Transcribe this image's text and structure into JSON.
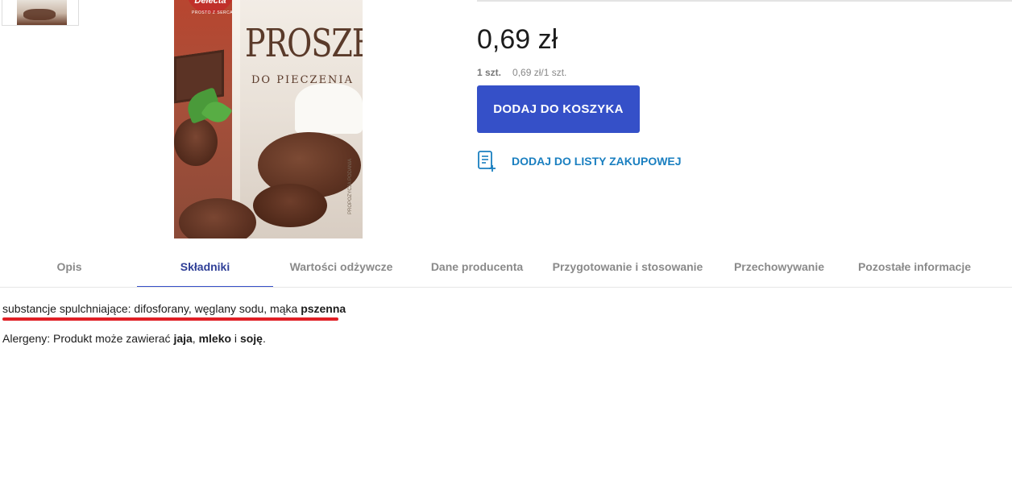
{
  "product": {
    "image_brand": "Delecta",
    "image_tagline": "PROSTO Z SERCA",
    "image_title": "PROSZEK",
    "image_subtitle": "DO PIECZENIA",
    "image_side_text": "PROPOZYCJA PODANIA"
  },
  "pricing": {
    "price": "0,69 zł",
    "unit_qty": "1 szt.",
    "unit_price": "0,69 zł/1 szt."
  },
  "actions": {
    "add_to_cart": "DODAJ DO KOSZYKA",
    "add_to_list": "DODAJ DO LISTY ZAKUPOWEJ",
    "list_icon": "shopping-list-add-icon"
  },
  "tabs": [
    {
      "label": "Opis",
      "active": false
    },
    {
      "label": "Składniki",
      "active": true
    },
    {
      "label": "Wartości odżywcze",
      "active": false
    },
    {
      "label": "Dane producenta",
      "active": false
    },
    {
      "label": "Przygotowanie i stosowanie",
      "active": false
    },
    {
      "label": "Przechowywanie",
      "active": false
    },
    {
      "label": "Pozostałe informacje",
      "active": false
    }
  ],
  "content": {
    "ingredients_prefix": "substancje spulchniające: difosforany, węglany sodu, mąka ",
    "ingredients_bold": "pszenna",
    "allergens_prefix": "Alergeny: Produkt może zawierać ",
    "allergen_1": "jaja",
    "sep_1": ", ",
    "allergen_2": "mleko",
    "sep_2": " i ",
    "allergen_3": "soję",
    "end": "."
  },
  "colors": {
    "primary_button": "#3550c8",
    "link": "#1a7fc0",
    "active_tab": "#2f3f97",
    "highlight_underline": "#e01f25"
  }
}
